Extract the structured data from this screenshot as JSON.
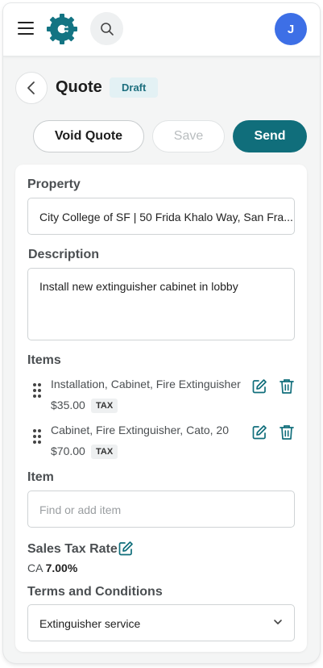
{
  "header": {
    "avatar_initial": "J",
    "icons": [
      "menu-icon",
      "app-logo",
      "search-icon"
    ]
  },
  "page": {
    "title": "Quote",
    "status": "Draft"
  },
  "actions": {
    "void_label": "Void Quote",
    "save_label": "Save",
    "send_label": "Send"
  },
  "form": {
    "property": {
      "label": "Property",
      "value": "City College of SF | 50 Frida Khalo Way, San Fra..."
    },
    "description": {
      "label": "Description",
      "value": "Install new extinguisher cabinet in lobby"
    },
    "items": {
      "label": "Items",
      "list": [
        {
          "name": "Installation, Cabinet, Fire Extinguisher",
          "price": "$35.00",
          "tax": "TAX"
        },
        {
          "name": "Cabinet, Fire Extinguisher, Cato, 20",
          "price": "$70.00",
          "tax": "TAX"
        }
      ]
    },
    "item_search": {
      "label": "Item",
      "placeholder": "Find or add item"
    },
    "sales_tax": {
      "label": "Sales Tax Rate",
      "region": "CA",
      "rate": "7.00%"
    },
    "terms": {
      "label": "Terms and Conditions",
      "value": "Extinguisher service"
    }
  },
  "colors": {
    "accent": "#106e7b",
    "avatar": "#3d6fe6",
    "badge_bg": "#e3f1f4"
  }
}
